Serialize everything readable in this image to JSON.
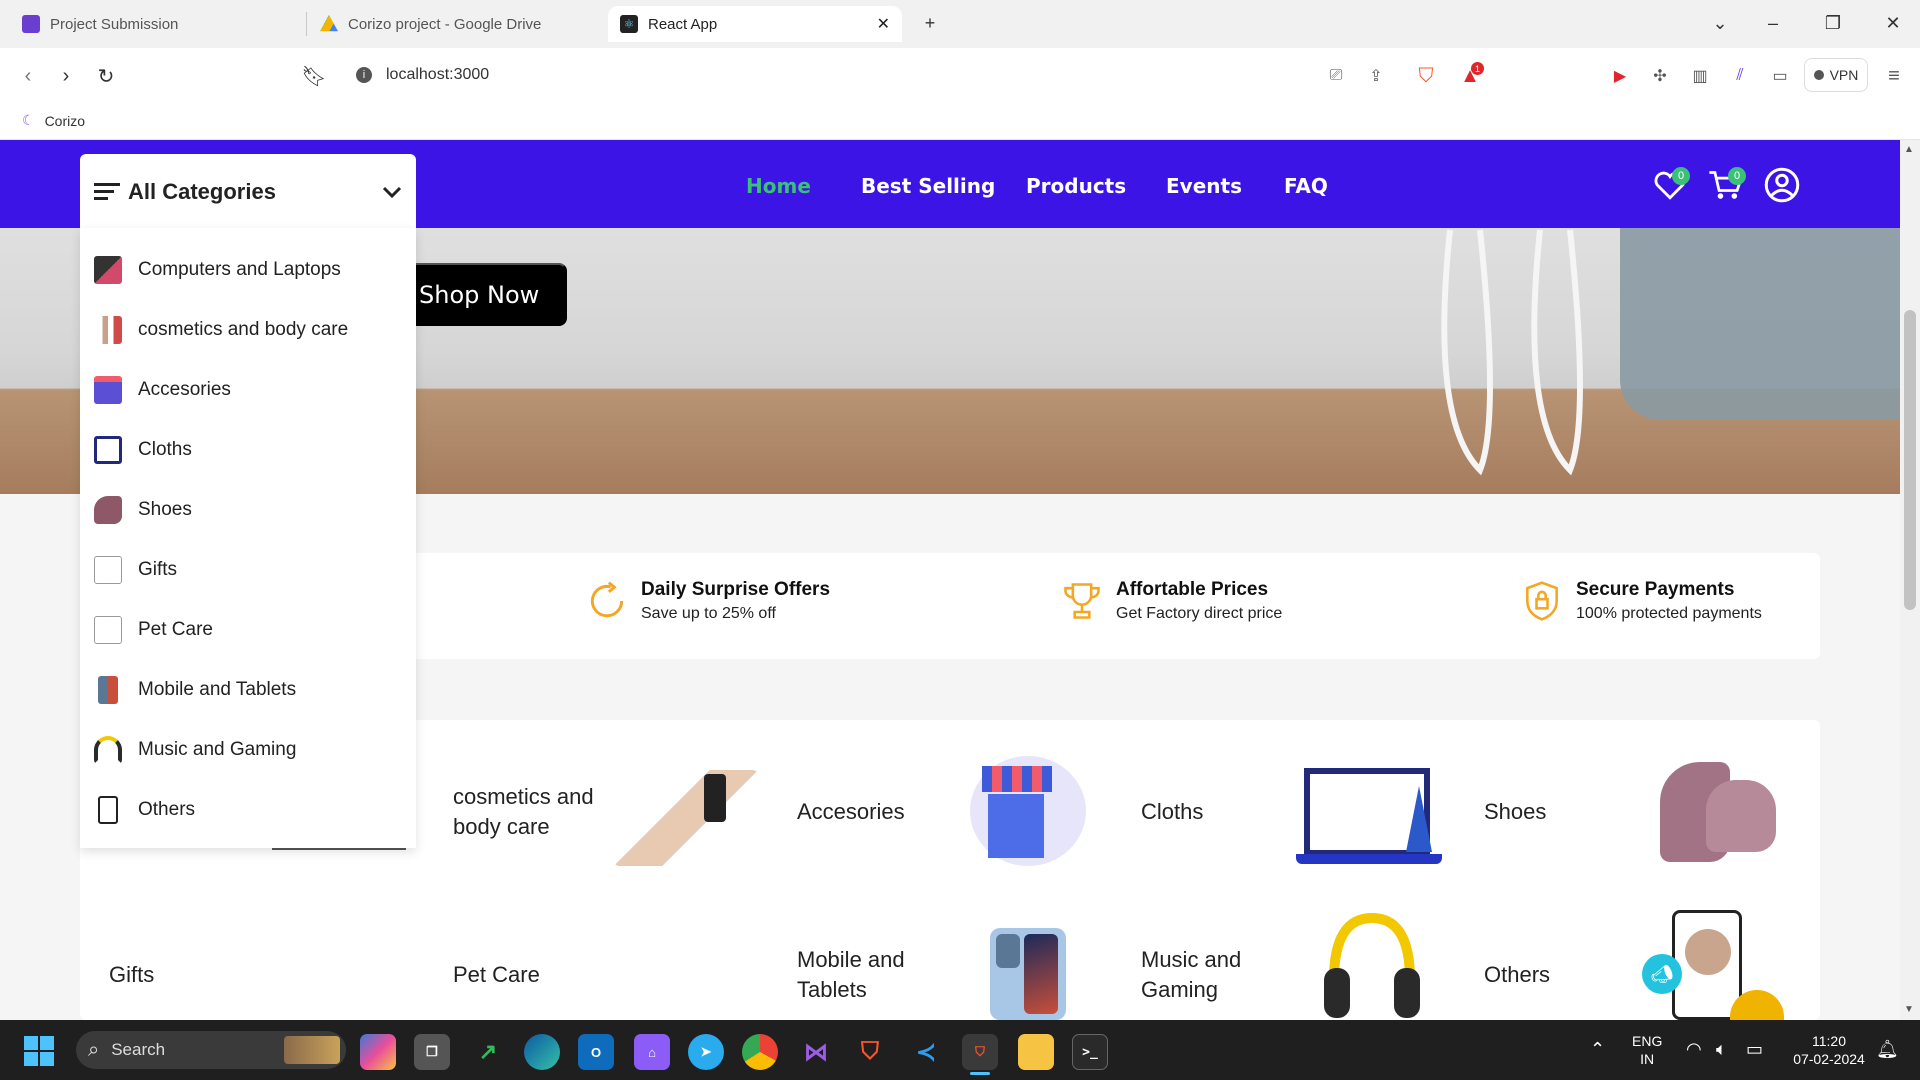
{
  "browser": {
    "tabs": [
      {
        "label": "Project Submission",
        "color": "#6a3fcf"
      },
      {
        "label": "Corizo project - Google Drive",
        "color": "#f4b400"
      },
      {
        "label": "React App",
        "color": "#222222"
      }
    ],
    "new_tab": "+",
    "url": "localhost:3000",
    "vpn_label": "VPN",
    "brave_alert_count": "1",
    "bookmark": "Corizo"
  },
  "navbar": {
    "color": "#3d14e6",
    "active_color": "#3bc177",
    "links": [
      "Home",
      "Best Selling",
      "Products",
      "Events",
      "FAQ"
    ],
    "wishlist_count": "0",
    "cart_count": "0"
  },
  "hero": {
    "button": "Shop Now"
  },
  "categories_dropdown": {
    "title": "All Categories",
    "items": [
      {
        "label": "Computers and Laptops",
        "icon": "laptop"
      },
      {
        "label": "cosmetics and body care",
        "icon": "cosmetics"
      },
      {
        "label": "Accesories",
        "icon": "accessories"
      },
      {
        "label": "Cloths",
        "icon": "cloths"
      },
      {
        "label": "Shoes",
        "icon": "shoes"
      },
      {
        "label": "Gifts",
        "icon": "broken-image"
      },
      {
        "label": "Pet Care",
        "icon": "broken-image"
      },
      {
        "label": "Mobile and Tablets",
        "icon": "mobile"
      },
      {
        "label": "Music and Gaming",
        "icon": "headphones"
      },
      {
        "label": "Others",
        "icon": "others"
      }
    ]
  },
  "features": [
    {
      "title": "Daily Surprise Offers",
      "subtitle": "Save up to 25% off",
      "icon": "refresh-icon"
    },
    {
      "title": "Affortable Prices",
      "subtitle": "Get Factory direct price",
      "icon": "trophy-icon"
    },
    {
      "title": "Secure Payments",
      "subtitle": "100% protected payments",
      "icon": "lock-shield-icon"
    }
  ],
  "category_grid": {
    "row1": [
      "cosmetics and body care",
      "Accesories",
      "Cloths",
      "Shoes"
    ],
    "row2": [
      "Gifts",
      "Pet Care",
      "Mobile and Tablets",
      "Music and Gaming",
      "Others"
    ]
  },
  "taskbar": {
    "search": "Search",
    "lang": "ENG",
    "region": "IN",
    "time": "11:20",
    "date": "07-02-2024"
  }
}
